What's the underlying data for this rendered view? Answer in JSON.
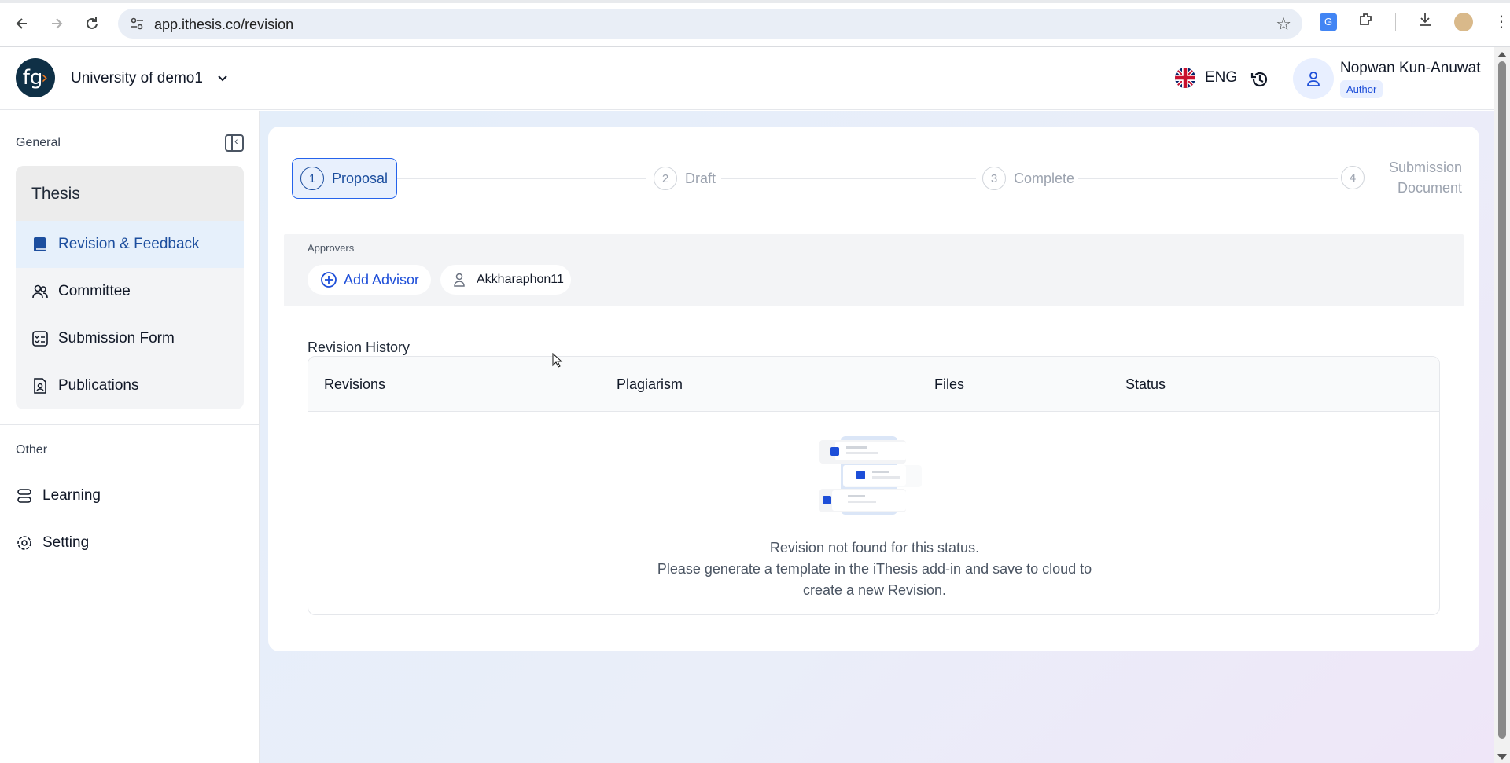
{
  "browser": {
    "url": "app.ithesis.co/revision"
  },
  "header": {
    "org_name": "University of demo1",
    "logo_text": "fg",
    "language": "ENG",
    "user_name": "Nopwan Kun-Anuwat",
    "user_role": "Author"
  },
  "sidebar": {
    "general_label": "General",
    "group_title": "Thesis",
    "items": [
      {
        "label": "Revision & Feedback",
        "icon": "book-icon",
        "active": true
      },
      {
        "label": "Committee",
        "icon": "users-icon"
      },
      {
        "label": "Submission Form",
        "icon": "checklist-icon"
      },
      {
        "label": "Publications",
        "icon": "document-person-icon"
      }
    ],
    "other_label": "Other",
    "other_items": [
      {
        "label": "Learning",
        "icon": "stack-icon"
      },
      {
        "label": "Setting",
        "icon": "gear-icon"
      }
    ]
  },
  "stepper": {
    "steps": [
      {
        "num": "1",
        "label": "Proposal",
        "active": true
      },
      {
        "num": "2",
        "label": "Draft"
      },
      {
        "num": "3",
        "label": "Complete"
      },
      {
        "num": "4",
        "label_line1": "Submission",
        "label_line2": "Document"
      }
    ]
  },
  "approvers": {
    "label": "Approvers",
    "add_label": "Add Advisor",
    "person": "Akkharaphon11"
  },
  "revision_history": {
    "title": "Revision History",
    "columns": [
      "Revisions",
      "Plagiarism",
      "Files",
      "Status"
    ],
    "empty_line1": "Revision not found for this status.",
    "empty_line2": "Please generate a template in the iThesis add-in and save to cloud to",
    "empty_line3": "create a new Revision."
  },
  "colors": {
    "accent": "#1c4e9e",
    "logo_bg": "#0f3046",
    "logo_accent": "#f47b20"
  }
}
